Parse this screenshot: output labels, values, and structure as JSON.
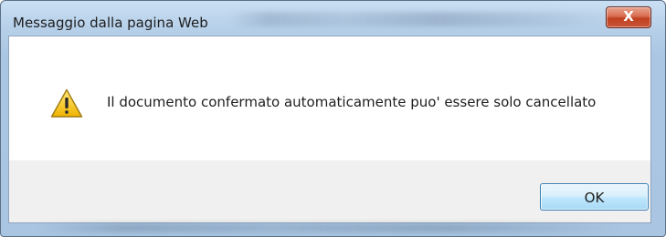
{
  "dialog": {
    "title": "Messaggio dalla pagina Web",
    "close_label": "X",
    "message": "Il documento confermato automaticamente puo' essere solo cancellato",
    "icon": "warning-icon",
    "ok_label": "OK"
  },
  "colors": {
    "frame": "#b7d0e9",
    "close_button": "#c9563a",
    "ok_button": "#bee6fd",
    "warning_fill": "#f5c400"
  }
}
